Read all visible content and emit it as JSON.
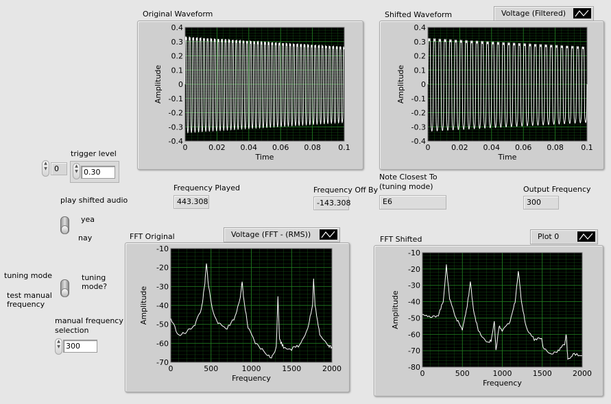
{
  "controls": {
    "trigger_index_value": "0",
    "trigger_level_label": "trigger level",
    "trigger_level_value": "0.30",
    "play_shifted_audio_label": "play shifted audio",
    "yea_label": "yea",
    "nay_label": "nay",
    "tuning_mode_label": "tuning mode",
    "test_manual_frequency_label": "test manual\nfrequency",
    "tuning_mode_question_label": "tuning\nmode?",
    "manual_frequency_selection_label": "manual frequency\nselection",
    "manual_frequency_value": "300"
  },
  "indicators": {
    "frequency_played_label": "Frequency Played",
    "frequency_played_value": "443.308",
    "frequency_off_by_label": "Frequency Off By",
    "frequency_off_by_value": "-143.308",
    "note_closest_label": "Note Closest To\n(tuning mode)",
    "note_closest_value": "E6",
    "output_frequency_label": "Output Frequency",
    "output_frequency_value": "300"
  },
  "colors": {
    "plot_background": "#000000",
    "grid": "#1f7a1f",
    "trace": "#ffffff",
    "panel": "#e6e6e6"
  },
  "chart_data": [
    {
      "type": "line",
      "id": "original",
      "title": "Original Waveform",
      "xlabel": "Time",
      "ylabel": "Amplitude",
      "xlim": [
        0,
        0.1
      ],
      "ylim": [
        -0.4,
        0.4
      ],
      "xticks": [
        0,
        0.02,
        0.04,
        0.06,
        0.08,
        0.1
      ],
      "yticks": [
        -0.4,
        -0.3,
        -0.2,
        -0.1,
        0,
        0.1,
        0.2,
        0.3,
        0.4
      ],
      "xtick_labels": [
        "0",
        "0.02",
        "0.04",
        "0.06",
        "0.08",
        "0.1"
      ],
      "ytick_labels": [
        "-0.4",
        "-0.3",
        "-0.2",
        "-0.1",
        "0",
        "0.1",
        "0.2",
        "0.3",
        "0.4"
      ],
      "legend": "",
      "series": [
        {
          "frequency_hz": 443.308,
          "amplitude_start": 0.33,
          "amplitude_end": 0.26
        }
      ]
    },
    {
      "type": "line",
      "id": "shifted",
      "title": "Shifted Waveform",
      "xlabel": "Time",
      "ylabel": "Amplitude",
      "xlim": [
        0,
        0.1
      ],
      "ylim": [
        -0.4,
        0.4
      ],
      "xticks": [
        0,
        0.02,
        0.04,
        0.06,
        0.08,
        0.1
      ],
      "yticks": [
        -0.4,
        -0.3,
        -0.2,
        -0.1,
        0,
        0.1,
        0.2,
        0.3,
        0.4
      ],
      "xtick_labels": [
        "0",
        "0.02",
        "0.04",
        "0.06",
        "0.08",
        "0.1"
      ],
      "ytick_labels": [
        "-0.4",
        "-0.3",
        "-0.2",
        "-0.1",
        "0",
        "0.1",
        "0.2",
        "0.3",
        "0.4"
      ],
      "legend": "Voltage (Filtered)",
      "series": [
        {
          "name": "Voltage (Filtered)",
          "frequency_hz": 300,
          "amplitude_start": 0.32,
          "amplitude_end": 0.26
        }
      ]
    },
    {
      "type": "line",
      "id": "fft_original",
      "title": "FFT Original",
      "xlabel": "Frequency",
      "ylabel": "Amplitude",
      "xlim": [
        0,
        2000
      ],
      "ylim": [
        -70,
        -10
      ],
      "xticks": [
        0,
        500,
        1000,
        1500,
        2000
      ],
      "yticks": [
        -70,
        -60,
        -50,
        -40,
        -30,
        -20,
        -10
      ],
      "xtick_labels": [
        "0",
        "500",
        "1000",
        "1500",
        "2000"
      ],
      "ytick_labels": [
        "-70",
        "-60",
        "-50",
        "-40",
        "-30",
        "-20",
        "-10"
      ],
      "legend": "Voltage (FFT - (RMS))",
      "series": [
        {
          "name": "Voltage (FFT - (RMS))",
          "x": [
            0,
            100,
            200,
            300,
            380,
            420,
            443,
            470,
            520,
            600,
            700,
            800,
            860,
            886,
            910,
            960,
            1050,
            1150,
            1250,
            1310,
            1330,
            1350,
            1400,
            1500,
            1600,
            1700,
            1760,
            1773,
            1790,
            1850,
            1950,
            2000
          ],
          "y": [
            -47,
            -56,
            -54,
            -50,
            -42,
            -30,
            -18,
            -30,
            -43,
            -50,
            -52,
            -46,
            -36,
            -28,
            -38,
            -52,
            -60,
            -64,
            -68,
            -62,
            -35,
            -58,
            -62,
            -63,
            -61,
            -52,
            -40,
            -26,
            -40,
            -55,
            -61,
            -62
          ]
        }
      ]
    },
    {
      "type": "line",
      "id": "fft_shifted",
      "title": "FFT Shifted",
      "xlabel": "Frequency",
      "ylabel": "Amplitude",
      "xlim": [
        0,
        2000
      ],
      "ylim": [
        -80,
        -10
      ],
      "xticks": [
        0,
        500,
        1000,
        1500,
        2000
      ],
      "yticks": [
        -80,
        -70,
        -60,
        -50,
        -40,
        -30,
        -20,
        -10
      ],
      "xtick_labels": [
        "0",
        "500",
        "1000",
        "1500",
        "2000"
      ],
      "ytick_labels": [
        "-80",
        "-70",
        "-60",
        "-50",
        "-40",
        "-30",
        "-20",
        "-10"
      ],
      "legend": "Plot 0",
      "series": [
        {
          "name": "Plot 0",
          "x": [
            0,
            100,
            200,
            260,
            300,
            340,
            420,
            500,
            560,
            600,
            640,
            700,
            800,
            860,
            900,
            920,
            960,
            1000,
            1100,
            1160,
            1200,
            1240,
            1300,
            1400,
            1490,
            1510,
            1600,
            1700,
            1780,
            1800,
            1820,
            1900,
            2000
          ],
          "y": [
            -47,
            -50,
            -48,
            -40,
            -18,
            -38,
            -50,
            -57,
            -43,
            -28,
            -45,
            -58,
            -65,
            -64,
            -52,
            -70,
            -55,
            -58,
            -52,
            -40,
            -21,
            -40,
            -56,
            -63,
            -62,
            -68,
            -72,
            -70,
            -66,
            -60,
            -75,
            -72,
            -73
          ]
        }
      ]
    }
  ]
}
